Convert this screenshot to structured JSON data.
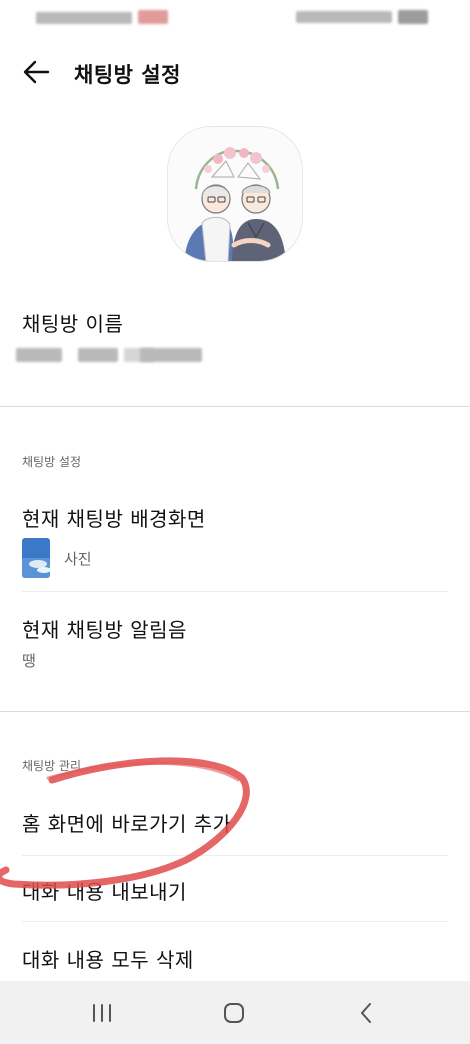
{
  "header": {
    "title": "채팅방 설정"
  },
  "chatroom_name": {
    "label": "채팅방 이름"
  },
  "chatroom_settings": {
    "section_label": "채팅방 설정",
    "wallpaper_title": "현재 채팅방 배경화면",
    "wallpaper_value": "사진",
    "notification_title": "현재 채팅방 알림음",
    "notification_value": "땡"
  },
  "chatroom_management": {
    "section_label": "채팅방 관리",
    "items": [
      {
        "label": "홈 화면에 바로가기 추가"
      },
      {
        "label": "대화 내용 내보내기"
      },
      {
        "label": "대화 내용 모두 삭제"
      }
    ]
  },
  "colors": {
    "annotation": "#e04b4b",
    "nav_bar": "#f1f1f1",
    "divider": "#dcdcdc"
  },
  "icons": {
    "back": "arrow-left-icon",
    "recent_apps": "recent-apps-icon",
    "home": "home-icon",
    "nav_back": "chevron-left-icon"
  }
}
